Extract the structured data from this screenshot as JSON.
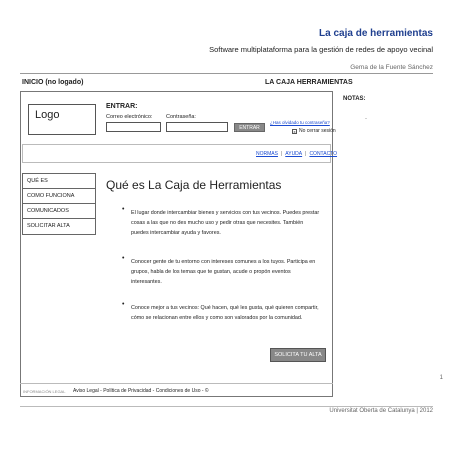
{
  "doc": {
    "title": "La caja de herramientas",
    "subtitle": "Software multiplataforma para la gestión de redes de apoyo vecinal",
    "author": "Gema de la Fuente Sánchez",
    "page_number": "1",
    "credit": "Universitat Oberta de Catalunya | 2012"
  },
  "wireframe": {
    "page_name": "INICIO (no logado)",
    "app_name": "LA CAJA HERRAMIENTAS",
    "logo": "Logo",
    "login": {
      "title": "ENTRAR:",
      "email_label": "Correo electrónico:",
      "password_label": "Contraseña:",
      "enter_label": "ENTRAR",
      "forgot_label": "¿Has olvidado tu contraseña?",
      "keep_label": "No cerrar sesión",
      "keep_mark": "x"
    },
    "top_links": [
      "NORMAS",
      "AYUDA",
      "CONTACTO"
    ],
    "nav": [
      "QUÉ ES",
      "COMO FUNCIONA",
      "COMUNICADOS",
      "SOLICITAR ALTA"
    ],
    "main": {
      "title": "Qué es La Caja de Herramientas",
      "bullets": [
        "El lugar donde intercambiar bienes y servicios con tus vecinos. Puedes prestar cosas a las que no des mucho uso y pedir otras que necesites. También puedes intercambiar ayuda y favores.",
        "Conocer gente de tu entorno con intereses comunes a los tuyos. Participa en grupos, habla de los temas que te gustan, acude o propón eventos interesantes.",
        "Conoce mejor a tus vecinos: Qué hacen, qué les gusta, qué quieren compartir, cómo se relacionan entre ellos y como son valorados por la comunidad."
      ],
      "cta": "SOLICITA TU ALTA"
    },
    "footer": {
      "label": "INFORMACIÓN LEGAL",
      "links": "Aviso Legal -  Política de Privacidad - Condiciones de Uso -  ©"
    }
  },
  "notes": {
    "title": "NOTAS:",
    "content": "-"
  }
}
